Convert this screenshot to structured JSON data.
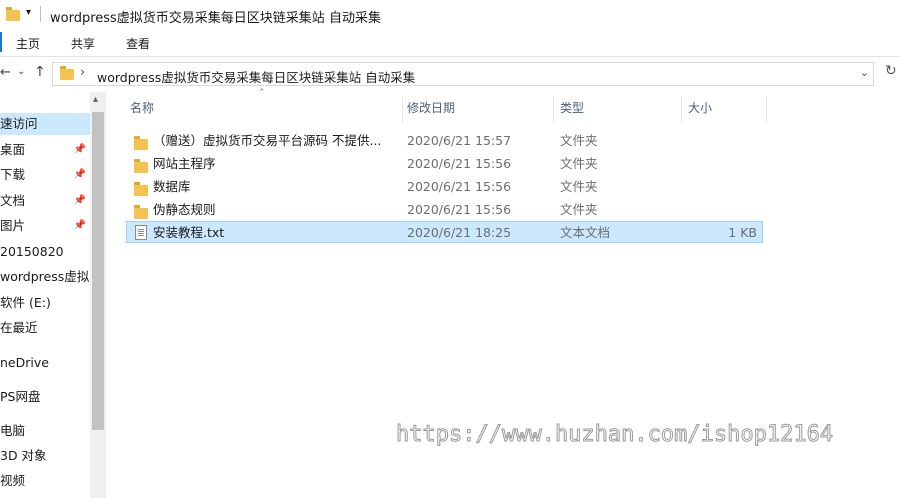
{
  "window": {
    "title": "wordpress虚拟货币交易采集每日区块链采集站 自动采集"
  },
  "ribbon": {
    "tabs": [
      "主页",
      "共享",
      "查看"
    ]
  },
  "address": {
    "path": "wordpress虚拟货币交易采集每日区块链采集站 自动采集"
  },
  "nav": {
    "items": [
      {
        "label": "速访问",
        "selected": true,
        "pinned": false
      },
      {
        "label": "桌面",
        "selected": false,
        "pinned": true
      },
      {
        "label": "下载",
        "selected": false,
        "pinned": true
      },
      {
        "label": "文档",
        "selected": false,
        "pinned": true
      },
      {
        "label": "图片",
        "selected": false,
        "pinned": true
      },
      {
        "label": "20150820",
        "selected": false,
        "pinned": false
      },
      {
        "label": "wordpress虚拟",
        "selected": false,
        "pinned": false
      },
      {
        "label": "软件 (E:)",
        "selected": false,
        "pinned": false
      },
      {
        "label": "在最近",
        "selected": false,
        "pinned": false
      },
      {
        "label": "neDrive",
        "selected": false,
        "pinned": false
      },
      {
        "label": "PS网盘",
        "selected": false,
        "pinned": false
      },
      {
        "label": "电脑",
        "selected": false,
        "pinned": false
      },
      {
        "label": "3D 对象",
        "selected": false,
        "pinned": false
      },
      {
        "label": "视频",
        "selected": false,
        "pinned": false
      }
    ]
  },
  "columns": {
    "name": "名称",
    "modified": "修改日期",
    "type": "类型",
    "size": "大小"
  },
  "files": [
    {
      "name": "（赠送）虚拟货币交易平台源码 不提供...",
      "modified": "2020/6/21 15:57",
      "type": "文件夹",
      "size": "",
      "icon": "folder-icon",
      "selected": false
    },
    {
      "name": "网站主程序",
      "modified": "2020/6/21 15:56",
      "type": "文件夹",
      "size": "",
      "icon": "folder-icon",
      "selected": false
    },
    {
      "name": "数据库",
      "modified": "2020/6/21 15:56",
      "type": "文件夹",
      "size": "",
      "icon": "folder-icon",
      "selected": false
    },
    {
      "name": "伪静态规则",
      "modified": "2020/6/21 15:56",
      "type": "文件夹",
      "size": "",
      "icon": "folder-icon",
      "selected": false
    },
    {
      "name": "安装教程.txt",
      "modified": "2020/6/21 18:25",
      "type": "文本文档",
      "size": "1 KB",
      "icon": "text-file-icon",
      "selected": true
    }
  ],
  "watermark": "https://www.huzhan.com/ishop12164",
  "colors": {
    "selection": "#cce8ff",
    "selection_border": "#99d1ff",
    "folder": "#f4c34f",
    "header_text": "#4c607a"
  }
}
